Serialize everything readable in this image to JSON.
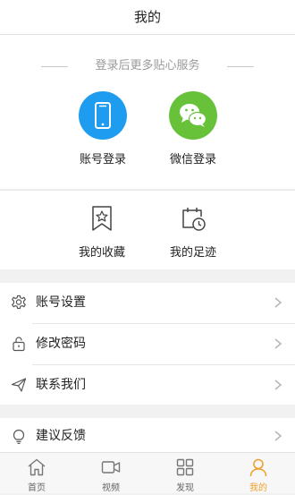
{
  "header": {
    "title": "我的"
  },
  "login": {
    "hint": "登录后更多贴心服务",
    "phone_label": "账号登录",
    "wechat_label": "微信登录"
  },
  "shortcuts": {
    "favorites_label": "我的收藏",
    "history_label": "我的足迹"
  },
  "menu": {
    "items": [
      {
        "label": "账号设置",
        "icon": "gear-icon"
      },
      {
        "label": "修改密码",
        "icon": "lock-icon"
      },
      {
        "label": "联系我们",
        "icon": "send-icon"
      }
    ],
    "feedback_label": "建议反馈"
  },
  "tabbar": {
    "tabs": [
      {
        "label": "首页",
        "icon": "home-icon"
      },
      {
        "label": "视频",
        "icon": "video-icon"
      },
      {
        "label": "发现",
        "icon": "grid-icon"
      },
      {
        "label": "我的",
        "icon": "person-icon"
      }
    ],
    "active_index": 3
  },
  "colors": {
    "accent": "#f0a030",
    "phone_blue": "#1e9cf0",
    "wechat_green": "#67c23a"
  }
}
